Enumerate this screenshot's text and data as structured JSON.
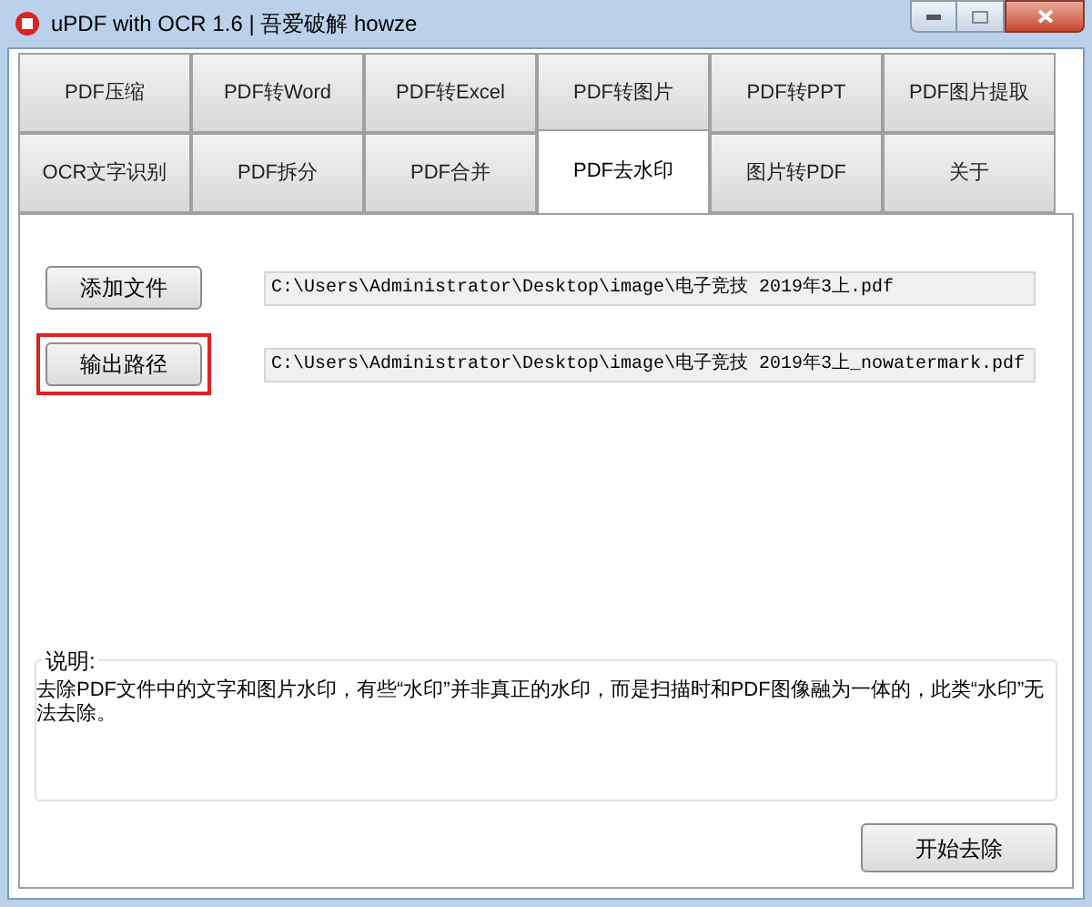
{
  "window": {
    "title": "uPDF with OCR 1.6 |  吾爱破解 howze"
  },
  "tab_rows": [
    [
      {
        "label": "PDF压缩",
        "selected": false
      },
      {
        "label": "PDF转Word",
        "selected": false
      },
      {
        "label": "PDF转Excel",
        "selected": false
      },
      {
        "label": "PDF转图片",
        "selected": false
      },
      {
        "label": "PDF转PPT",
        "selected": false
      },
      {
        "label": "PDF图片提取",
        "selected": false
      }
    ],
    [
      {
        "label": "OCR文字识别",
        "selected": false
      },
      {
        "label": "PDF拆分",
        "selected": false
      },
      {
        "label": "PDF合并",
        "selected": false
      },
      {
        "label": "PDF去水印",
        "selected": true
      },
      {
        "label": "图片转PDF",
        "selected": false
      },
      {
        "label": "关于",
        "selected": false
      }
    ]
  ],
  "file_rows": [
    {
      "button": "添加文件",
      "highlighted": false,
      "path": "C:\\Users\\Administrator\\Desktop\\image\\电子竞技 2019年3上.pdf"
    },
    {
      "button": "输出路径",
      "highlighted": true,
      "path": "C:\\Users\\Administrator\\Desktop\\image\\电子竞技 2019年3上_nowatermark.pdf"
    }
  ],
  "description": {
    "title": "说明:",
    "text": "去除PDF文件中的文字和图片水印，有些“水印”并非真正的水印，而是扫描时和PDF图像融为一体的，此类“水印”无法去除。"
  },
  "start_button": "开始去除"
}
